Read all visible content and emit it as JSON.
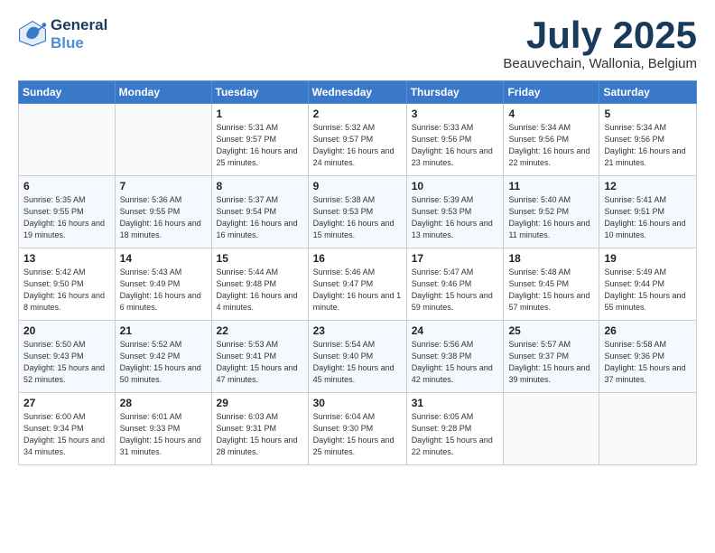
{
  "header": {
    "logo_line1": "General",
    "logo_line2": "Blue",
    "month": "July 2025",
    "location": "Beauvechain, Wallonia, Belgium"
  },
  "days_of_week": [
    "Sunday",
    "Monday",
    "Tuesday",
    "Wednesday",
    "Thursday",
    "Friday",
    "Saturday"
  ],
  "weeks": [
    [
      {
        "day": "",
        "info": ""
      },
      {
        "day": "",
        "info": ""
      },
      {
        "day": "1",
        "info": "Sunrise: 5:31 AM\nSunset: 9:57 PM\nDaylight: 16 hours and 25 minutes."
      },
      {
        "day": "2",
        "info": "Sunrise: 5:32 AM\nSunset: 9:57 PM\nDaylight: 16 hours and 24 minutes."
      },
      {
        "day": "3",
        "info": "Sunrise: 5:33 AM\nSunset: 9:56 PM\nDaylight: 16 hours and 23 minutes."
      },
      {
        "day": "4",
        "info": "Sunrise: 5:34 AM\nSunset: 9:56 PM\nDaylight: 16 hours and 22 minutes."
      },
      {
        "day": "5",
        "info": "Sunrise: 5:34 AM\nSunset: 9:56 PM\nDaylight: 16 hours and 21 minutes."
      }
    ],
    [
      {
        "day": "6",
        "info": "Sunrise: 5:35 AM\nSunset: 9:55 PM\nDaylight: 16 hours and 19 minutes."
      },
      {
        "day": "7",
        "info": "Sunrise: 5:36 AM\nSunset: 9:55 PM\nDaylight: 16 hours and 18 minutes."
      },
      {
        "day": "8",
        "info": "Sunrise: 5:37 AM\nSunset: 9:54 PM\nDaylight: 16 hours and 16 minutes."
      },
      {
        "day": "9",
        "info": "Sunrise: 5:38 AM\nSunset: 9:53 PM\nDaylight: 16 hours and 15 minutes."
      },
      {
        "day": "10",
        "info": "Sunrise: 5:39 AM\nSunset: 9:53 PM\nDaylight: 16 hours and 13 minutes."
      },
      {
        "day": "11",
        "info": "Sunrise: 5:40 AM\nSunset: 9:52 PM\nDaylight: 16 hours and 11 minutes."
      },
      {
        "day": "12",
        "info": "Sunrise: 5:41 AM\nSunset: 9:51 PM\nDaylight: 16 hours and 10 minutes."
      }
    ],
    [
      {
        "day": "13",
        "info": "Sunrise: 5:42 AM\nSunset: 9:50 PM\nDaylight: 16 hours and 8 minutes."
      },
      {
        "day": "14",
        "info": "Sunrise: 5:43 AM\nSunset: 9:49 PM\nDaylight: 16 hours and 6 minutes."
      },
      {
        "day": "15",
        "info": "Sunrise: 5:44 AM\nSunset: 9:48 PM\nDaylight: 16 hours and 4 minutes."
      },
      {
        "day": "16",
        "info": "Sunrise: 5:46 AM\nSunset: 9:47 PM\nDaylight: 16 hours and 1 minute."
      },
      {
        "day": "17",
        "info": "Sunrise: 5:47 AM\nSunset: 9:46 PM\nDaylight: 15 hours and 59 minutes."
      },
      {
        "day": "18",
        "info": "Sunrise: 5:48 AM\nSunset: 9:45 PM\nDaylight: 15 hours and 57 minutes."
      },
      {
        "day": "19",
        "info": "Sunrise: 5:49 AM\nSunset: 9:44 PM\nDaylight: 15 hours and 55 minutes."
      }
    ],
    [
      {
        "day": "20",
        "info": "Sunrise: 5:50 AM\nSunset: 9:43 PM\nDaylight: 15 hours and 52 minutes."
      },
      {
        "day": "21",
        "info": "Sunrise: 5:52 AM\nSunset: 9:42 PM\nDaylight: 15 hours and 50 minutes."
      },
      {
        "day": "22",
        "info": "Sunrise: 5:53 AM\nSunset: 9:41 PM\nDaylight: 15 hours and 47 minutes."
      },
      {
        "day": "23",
        "info": "Sunrise: 5:54 AM\nSunset: 9:40 PM\nDaylight: 15 hours and 45 minutes."
      },
      {
        "day": "24",
        "info": "Sunrise: 5:56 AM\nSunset: 9:38 PM\nDaylight: 15 hours and 42 minutes."
      },
      {
        "day": "25",
        "info": "Sunrise: 5:57 AM\nSunset: 9:37 PM\nDaylight: 15 hours and 39 minutes."
      },
      {
        "day": "26",
        "info": "Sunrise: 5:58 AM\nSunset: 9:36 PM\nDaylight: 15 hours and 37 minutes."
      }
    ],
    [
      {
        "day": "27",
        "info": "Sunrise: 6:00 AM\nSunset: 9:34 PM\nDaylight: 15 hours and 34 minutes."
      },
      {
        "day": "28",
        "info": "Sunrise: 6:01 AM\nSunset: 9:33 PM\nDaylight: 15 hours and 31 minutes."
      },
      {
        "day": "29",
        "info": "Sunrise: 6:03 AM\nSunset: 9:31 PM\nDaylight: 15 hours and 28 minutes."
      },
      {
        "day": "30",
        "info": "Sunrise: 6:04 AM\nSunset: 9:30 PM\nDaylight: 15 hours and 25 minutes."
      },
      {
        "day": "31",
        "info": "Sunrise: 6:05 AM\nSunset: 9:28 PM\nDaylight: 15 hours and 22 minutes."
      },
      {
        "day": "",
        "info": ""
      },
      {
        "day": "",
        "info": ""
      }
    ]
  ]
}
